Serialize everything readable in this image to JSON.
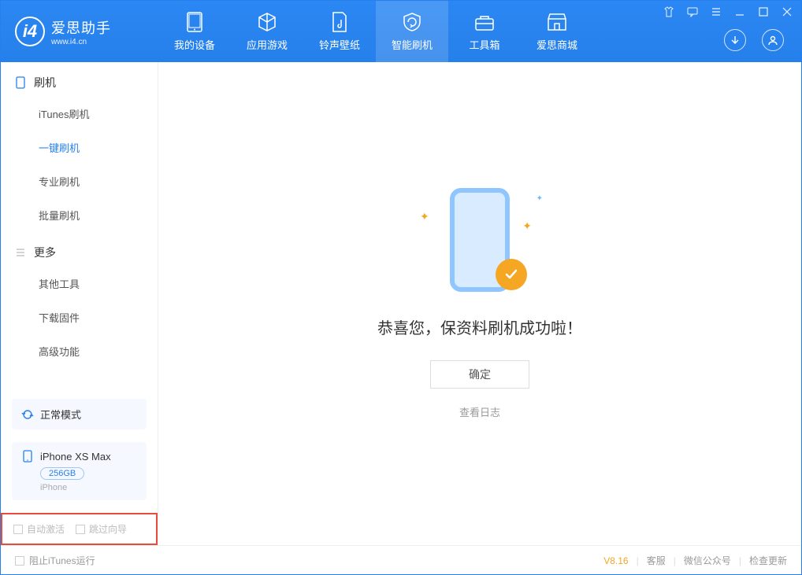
{
  "app": {
    "title": "爱思助手",
    "url": "www.i4.cn"
  },
  "tabs": [
    {
      "label": "我的设备"
    },
    {
      "label": "应用游戏"
    },
    {
      "label": "铃声壁纸"
    },
    {
      "label": "智能刷机"
    },
    {
      "label": "工具箱"
    },
    {
      "label": "爱思商城"
    }
  ],
  "sidebar": {
    "section1_title": "刷机",
    "section1_items": [
      "iTunes刷机",
      "一键刷机",
      "专业刷机",
      "批量刷机"
    ],
    "section2_title": "更多",
    "section2_items": [
      "其他工具",
      "下载固件",
      "高级功能"
    ]
  },
  "mode": {
    "label": "正常模式"
  },
  "device": {
    "name": "iPhone XS Max",
    "capacity": "256GB",
    "type": "iPhone"
  },
  "checkboxes": {
    "auto_activate": "自动激活",
    "skip_guide": "跳过向导"
  },
  "content": {
    "success_title": "恭喜您，保资料刷机成功啦！",
    "confirm_label": "确定",
    "view_log_label": "查看日志"
  },
  "footer": {
    "block_itunes": "阻止iTunes运行",
    "version": "V8.16",
    "links": [
      "客服",
      "微信公众号",
      "检查更新"
    ]
  }
}
